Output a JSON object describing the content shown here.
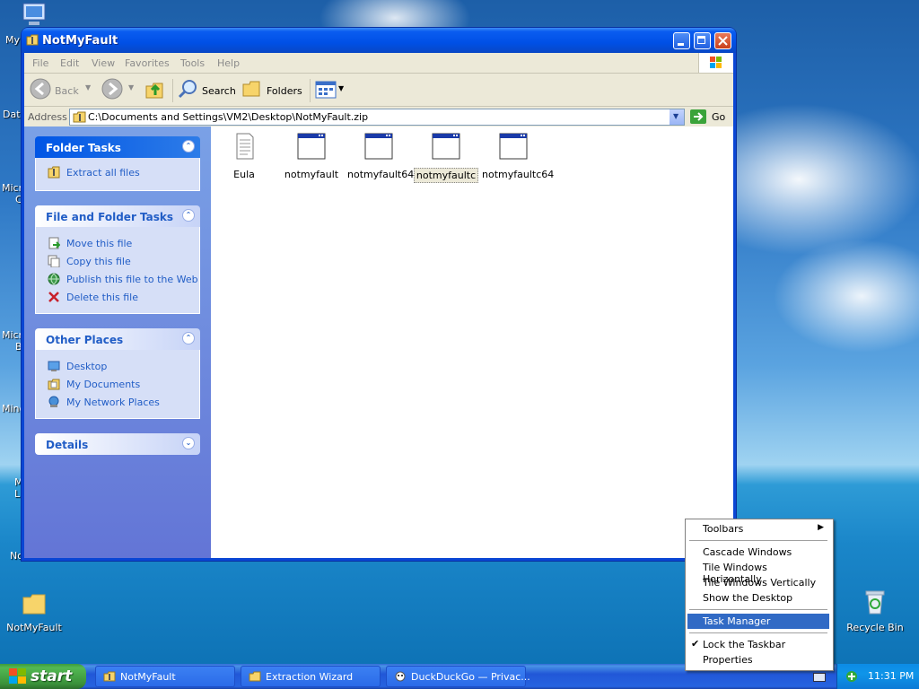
{
  "desktop": {
    "icons_left": [
      "My",
      "Dat",
      "Micro",
      "C",
      "Micro",
      "B",
      "Mine",
      "M",
      "L",
      "No"
    ],
    "notmyfault_icon": "NotMyFault",
    "recycle_bin": "Recycle Bin"
  },
  "window": {
    "title": "NotMyFault",
    "menu": [
      "File",
      "Edit",
      "View",
      "Favorites",
      "Tools",
      "Help"
    ],
    "toolbar": {
      "back": "Back",
      "search": "Search",
      "folders": "Folders"
    },
    "address": {
      "label": "Address",
      "value": "C:\\Documents and Settings\\VM2\\Desktop\\NotMyFault.zip",
      "go": "Go"
    },
    "task_panels": {
      "folder_tasks": {
        "title": "Folder Tasks",
        "items": [
          "Extract all files"
        ]
      },
      "file_folder_tasks": {
        "title": "File and Folder Tasks",
        "items": [
          "Move this file",
          "Copy this file",
          "Publish this file to the Web",
          "Delete this file"
        ]
      },
      "other_places": {
        "title": "Other Places",
        "items": [
          "Desktop",
          "My Documents",
          "My Network Places"
        ]
      },
      "details": {
        "title": "Details"
      }
    },
    "files": [
      "Eula",
      "notmyfault",
      "notmyfault64",
      "notmyfaultc",
      "notmyfaultc64"
    ]
  },
  "context_menu": {
    "items": [
      "Toolbars",
      "Cascade Windows",
      "Tile Windows Horizontally",
      "Tile Windows Vertically",
      "Show the Desktop",
      "Task Manager",
      "Lock the Taskbar",
      "Properties"
    ]
  },
  "taskbar": {
    "start": "start",
    "buttons": [
      "NotMyFault",
      "Extraction Wizard",
      "DuckDuckGo — Privac..."
    ],
    "clock": "11:31 PM"
  }
}
